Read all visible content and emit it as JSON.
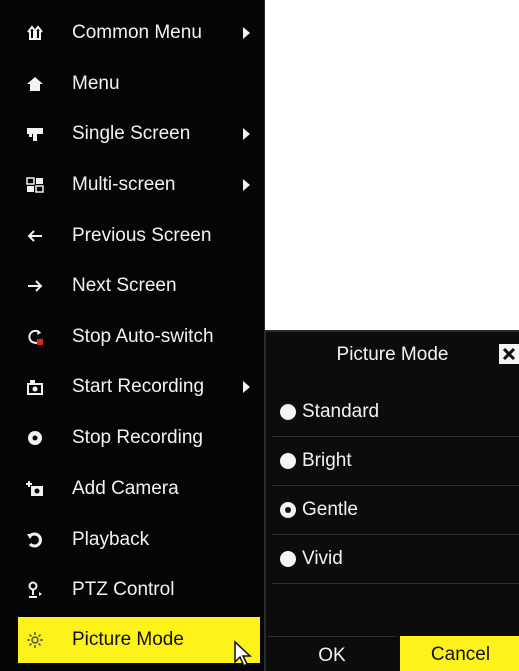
{
  "context_menu": {
    "items": [
      {
        "label": "Common Menu",
        "icon": "common-menu-icon",
        "has_submenu": true
      },
      {
        "label": "Menu",
        "icon": "home-icon",
        "has_submenu": false
      },
      {
        "label": "Single Screen",
        "icon": "single-screen-icon",
        "has_submenu": true
      },
      {
        "label": "Multi-screen",
        "icon": "multi-screen-icon",
        "has_submenu": true
      },
      {
        "label": "Previous Screen",
        "icon": "arrow-left-icon",
        "has_submenu": false
      },
      {
        "label": "Next Screen",
        "icon": "arrow-right-icon",
        "has_submenu": false
      },
      {
        "label": "Stop Auto-switch",
        "icon": "stop-auto-switch-icon",
        "has_submenu": false
      },
      {
        "label": "Start Recording",
        "icon": "start-recording-icon",
        "has_submenu": true
      },
      {
        "label": "Stop Recording",
        "icon": "stop-recording-icon",
        "has_submenu": false
      },
      {
        "label": "Add Camera",
        "icon": "add-camera-icon",
        "has_submenu": false
      },
      {
        "label": "Playback",
        "icon": "playback-icon",
        "has_submenu": false
      },
      {
        "label": "PTZ Control",
        "icon": "ptz-control-icon",
        "has_submenu": false
      },
      {
        "label": "Picture Mode",
        "icon": "picture-mode-icon",
        "has_submenu": false,
        "selected": true
      }
    ]
  },
  "dialog": {
    "title": "Picture Mode",
    "options": [
      {
        "label": "Standard",
        "checked": false
      },
      {
        "label": "Bright",
        "checked": false
      },
      {
        "label": "Gentle",
        "checked": true
      },
      {
        "label": "Vivid",
        "checked": false
      }
    ],
    "ok_label": "OK",
    "cancel_label": "Cancel"
  },
  "colors": {
    "menu_bg": "#050505",
    "highlight": "#fdf21a",
    "text": "#f2f2f2"
  }
}
